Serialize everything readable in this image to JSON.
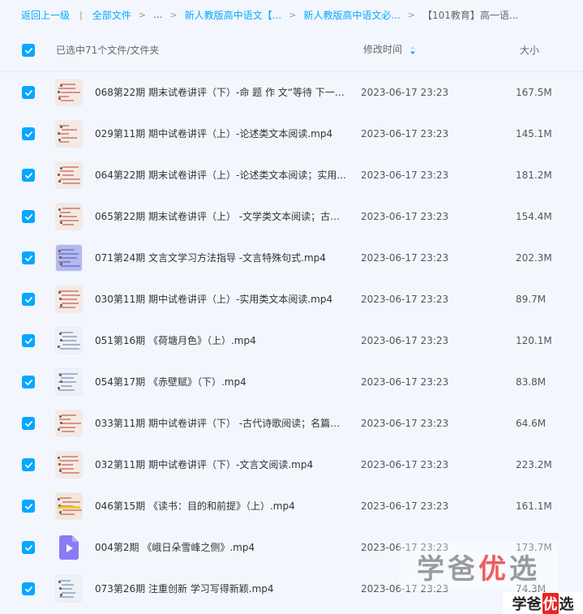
{
  "breadcrumb": {
    "back": "返回上一级",
    "all_files": "全部文件",
    "ellipsis": "...",
    "level1": "新人教版高中语文【...",
    "level2": "新人教版高中语文必...",
    "current": "【101教育】高一语..."
  },
  "header": {
    "selected_text": "已选中71个文件/文件夹",
    "modified_label": "修改时间",
    "size_label": "大小"
  },
  "colors": {
    "accent": "#06a7ff",
    "row_bg": "#f3f7fd"
  },
  "files": [
    {
      "name": "068第22期 期末试卷讲评（下）-命 题 作 文“等待 下一个...",
      "time": "2023-06-17 23:23",
      "size": "167.5M",
      "thumb": "pink"
    },
    {
      "name": "029第11期 期中试卷讲评（上）-论述类文本阅读.mp4",
      "time": "2023-06-17 23:23",
      "size": "145.1M",
      "thumb": "pink"
    },
    {
      "name": "064第22期 期末试卷讲评（上）-论述类文本阅读；实用...",
      "time": "2023-06-17 23:23",
      "size": "181.2M",
      "thumb": "pink"
    },
    {
      "name": "065第22期 期末试卷讲评（上） -文学类文本阅读；古代...",
      "time": "2023-06-17 23:23",
      "size": "154.4M",
      "thumb": "pink"
    },
    {
      "name": "071第24期 文言文学习方法指导 -文言特殊句式.mp4",
      "time": "2023-06-17 23:23",
      "size": "202.3M",
      "thumb": "blue"
    },
    {
      "name": "030第11期 期中试卷讲评（上）-实用类文本阅读.mp4",
      "time": "2023-06-17 23:23",
      "size": "89.7M",
      "thumb": "pink"
    },
    {
      "name": "051第16期 《荷塘月色》（上）.mp4",
      "time": "2023-06-17 23:23",
      "size": "120.1M",
      "thumb": "white"
    },
    {
      "name": "054第17期 《赤壁赋》（下）.mp4",
      "time": "2023-06-17 23:23",
      "size": "83.8M",
      "thumb": "white"
    },
    {
      "name": "033第11期 期中试卷讲评（下） -古代诗歌阅读；名篇名...",
      "time": "2023-06-17 23:23",
      "size": "64.6M",
      "thumb": "pink"
    },
    {
      "name": "032第11期 期中试卷讲评（下）-文言文阅读.mp4",
      "time": "2023-06-17 23:23",
      "size": "223.2M",
      "thumb": "pink"
    },
    {
      "name": "046第15期 《读书：目的和前提》（上）.mp4",
      "time": "2023-06-17 23:23",
      "size": "161.1M",
      "thumb": "yellow"
    },
    {
      "name": "004第2期 《峨日朵雪峰之侧》.mp4",
      "time": "2023-06-17 23:23",
      "size": "173.7M",
      "thumb": "video-icon"
    },
    {
      "name": "073第26期 注重创新 学习写得新颖.mp4",
      "time": "2023-06-17 23:23",
      "size": "74.3M",
      "thumb": "white"
    }
  ],
  "watermark": {
    "big_part1": "学爸",
    "big_part2": "优",
    "big_part3": "选",
    "small_part1": "学爸",
    "small_part2": "优",
    "small_part3": "选"
  }
}
